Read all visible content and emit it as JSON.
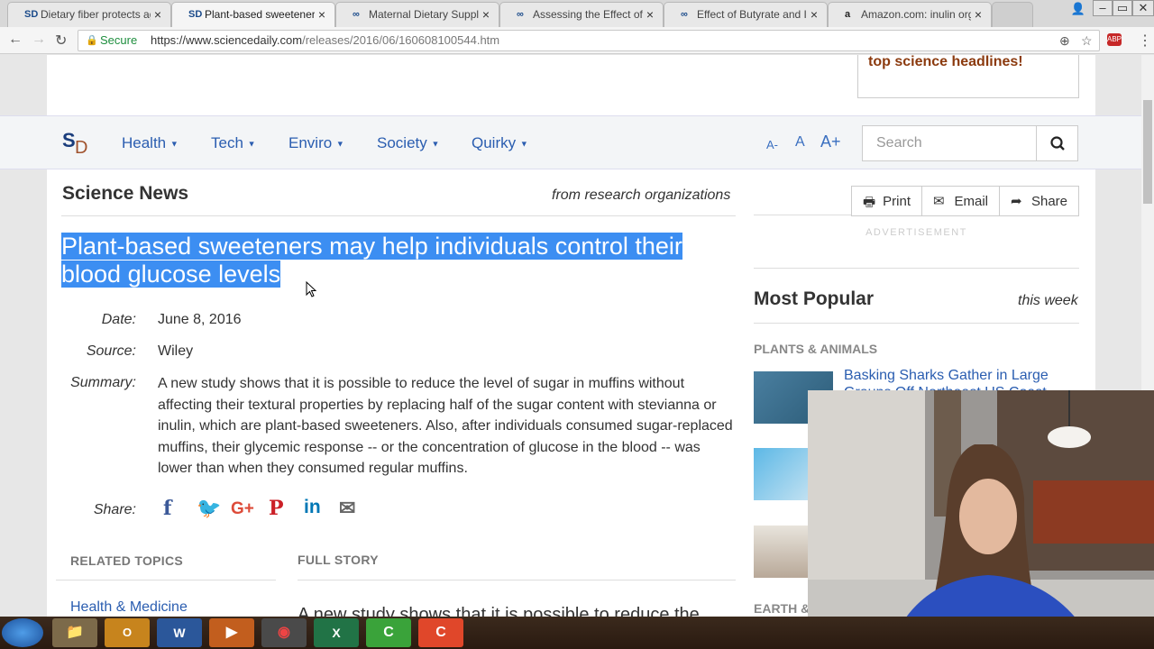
{
  "tabs": [
    {
      "title": "Dietary fiber protects ag",
      "icon": "sd-favicon",
      "active": false
    },
    {
      "title": "Plant-based sweeteners",
      "icon": "sd-favicon",
      "active": true
    },
    {
      "title": "Maternal Dietary Supple",
      "icon": "pubmed-favicon",
      "active": false
    },
    {
      "title": "Assessing the Effect of H",
      "icon": "pubmed-favicon",
      "active": false
    },
    {
      "title": "Effect of Butyrate and In",
      "icon": "pubmed-favicon",
      "active": false
    },
    {
      "title": "Amazon.com: inulin orga",
      "icon": "amazon-favicon",
      "active": false
    }
  ],
  "tab_close": "×",
  "toolbar": {
    "secure_label": "Secure",
    "url_host": "https://www.sciencedaily.com",
    "url_path": "/releases/2016/06/160608100544.htm"
  },
  "banner": {
    "headlines_text": "top science headlines!"
  },
  "nav": {
    "logo_s": "S",
    "logo_d": "D",
    "items": [
      "Health",
      "Tech",
      "Enviro",
      "Society",
      "Quirky"
    ],
    "font_small": "A-",
    "font_normal": "A",
    "font_large": "A+",
    "search_placeholder": "Search"
  },
  "article": {
    "section_title": "Science News",
    "section_from": "from research organizations",
    "headline_line1": "Plant-based sweeteners may help individuals control their",
    "headline_line2": "blood glucose levels",
    "date_label": "Date:",
    "date": "June 8, 2016",
    "source_label": "Source:",
    "source": "Wiley",
    "summary_label": "Summary:",
    "summary": "A new study shows that it is possible to reduce the level of sugar in muffins without affecting their textural properties by replacing half of the sugar content with stevianna or inulin, which are plant-based sweeteners. Also, after individuals consumed sugar-replaced muffins, their glycemic response -- or the concentration of glucose in the blood -- was lower than when they consumed regular muffins.",
    "share_label": "Share:",
    "related_topics": "RELATED TOPICS",
    "related_first": "Health & Medicine",
    "full_story": "FULL STORY",
    "full_story_start": "A new study shows that it is possible to reduce the"
  },
  "tools": {
    "print": "Print",
    "email": "Email",
    "share": "Share"
  },
  "sidebar": {
    "advertisement": "ADVERTISEMENT",
    "most_popular": "Most Popular",
    "this_week": "this week",
    "category1": "PLANTS & ANIMALS",
    "story1": "Basking Sharks Gather in Large Groups Off Northeast US Coast",
    "category2": "EARTH &"
  },
  "colors": {
    "link": "#2a5db0",
    "selection": "#3c8ef2",
    "brand_orange": "#8b3a0e",
    "secure_green": "#1e8e3e"
  }
}
